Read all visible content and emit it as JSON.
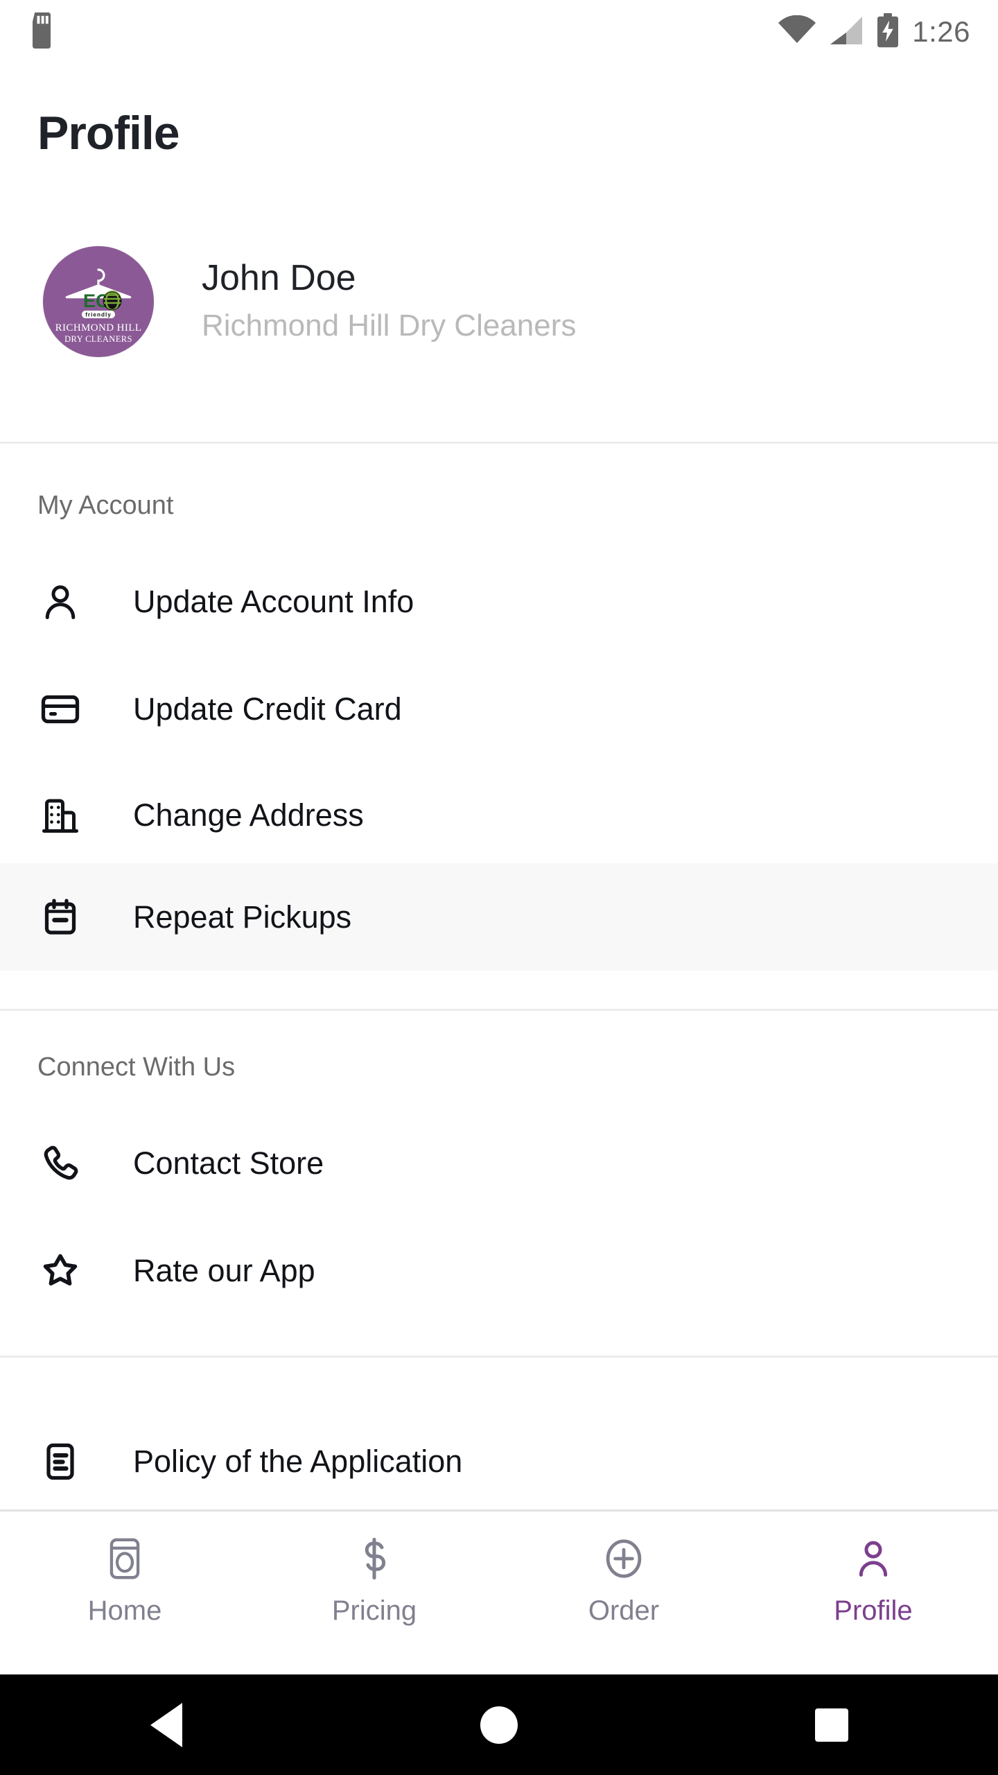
{
  "status_bar": {
    "time": "1:26",
    "icons": [
      "sd-card-icon",
      "wifi-icon",
      "cellular-signal-icon",
      "battery-charging-icon"
    ]
  },
  "page": {
    "title": "Profile"
  },
  "profile": {
    "name": "John Doe",
    "store": "Richmond Hill Dry Cleaners",
    "avatar": {
      "name": "richmond-hill-dry-cleaners-logo",
      "bg_color": "#8B5A96",
      "eco_text": "ECO",
      "friendly_text": "friendly",
      "line1": "RICHMOND HILL",
      "line2": "DRY CLEANERS"
    }
  },
  "sections": [
    {
      "label": "My Account",
      "items": [
        {
          "label": "Update Account Info",
          "icon": "person-icon",
          "active": false
        },
        {
          "label": "Update Credit Card",
          "icon": "credit-card-icon",
          "active": false
        },
        {
          "label": "Change Address",
          "icon": "building-icon",
          "active": false
        },
        {
          "label": "Repeat Pickups",
          "icon": "calendar-minus-icon",
          "active": true
        }
      ]
    },
    {
      "label": "Connect With Us",
      "items": [
        {
          "label": "Contact Store",
          "icon": "phone-icon",
          "active": false
        },
        {
          "label": "Rate our App",
          "icon": "star-icon",
          "active": false
        }
      ]
    },
    {
      "label": "",
      "items": [
        {
          "label": "Policy of the Application",
          "icon": "document-list-icon",
          "active": false
        }
      ]
    }
  ],
  "tab_bar": {
    "active_color": "#7C3F8E",
    "inactive_color": "#80808F",
    "tabs": [
      {
        "label": "Home",
        "icon": "washing-machine-icon",
        "active": false
      },
      {
        "label": "Pricing",
        "icon": "dollar-icon",
        "active": false
      },
      {
        "label": "Order",
        "icon": "plus-circle-icon",
        "active": false
      },
      {
        "label": "Profile",
        "icon": "person-icon",
        "active": true
      }
    ]
  },
  "nav_bar": {
    "buttons": [
      "back-button",
      "home-button",
      "recents-button"
    ]
  }
}
